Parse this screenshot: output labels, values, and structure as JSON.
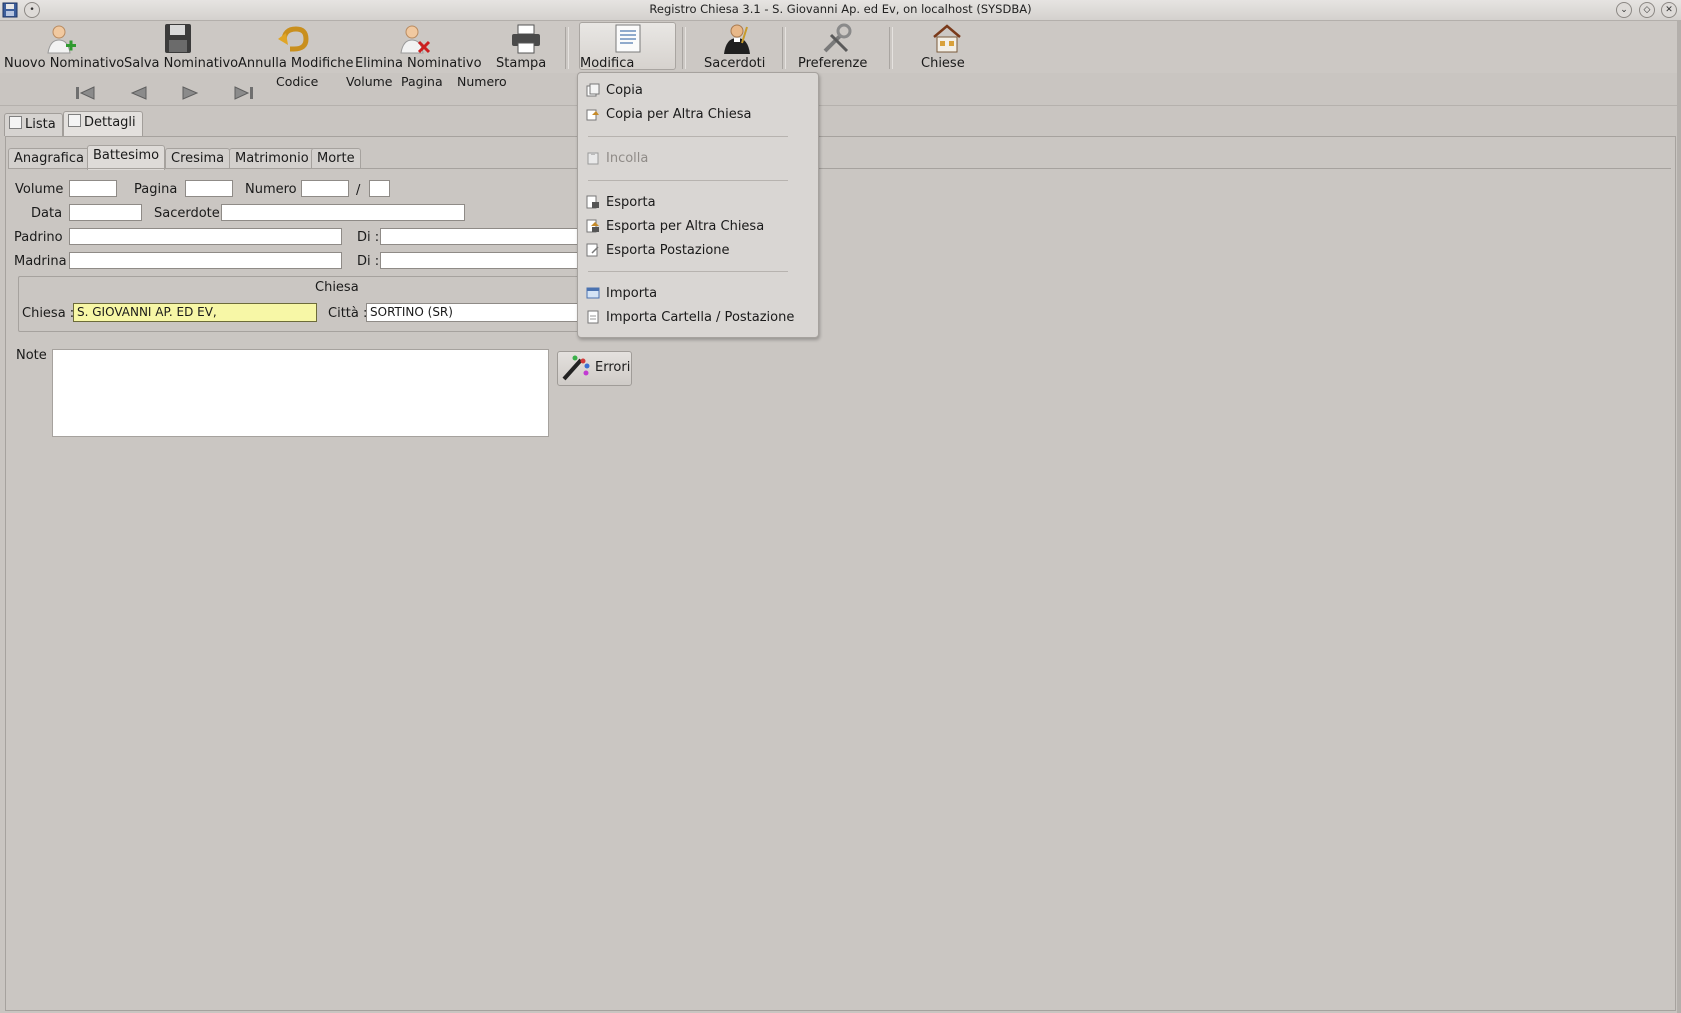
{
  "window": {
    "title": "Registro Chiesa 3.1 - S. Giovanni Ap. ed Ev, on localhost (SYSDBA)"
  },
  "toolbar": {
    "nuovo": "Nuovo Nominativo",
    "salva": "Salva Nominativo",
    "annulla": "Annulla Modifiche",
    "elimina": "Elimina Nominativo",
    "stampa": "Stampa",
    "modifica": "Modifica",
    "sacerdoti": "Sacerdoti",
    "preferenze": "Preferenze",
    "chiese": "Chiese",
    "sub_codice": "Codice",
    "sub_volume": "Volume",
    "sub_pagina": "Pagina",
    "sub_numero": "Numero"
  },
  "main_tabs": {
    "lista": "Lista",
    "dettagli": "Dettagli"
  },
  "sub_tabs": {
    "anagrafica": "Anagrafica",
    "battesimo": "Battesimo",
    "cresima": "Cresima",
    "matrimonio": "Matrimonio",
    "morte": "Morte"
  },
  "form": {
    "volume_label": "Volume",
    "pagina_label": "Pagina",
    "numero_label": "Numero",
    "slash": "/",
    "data_label": "Data",
    "sacerdote_label": "Sacerdote",
    "padrino_label": "Padrino",
    "madrina_label": "Madrina",
    "di_label": "Di :",
    "chiesa_group_title": "Chiesa",
    "chiesa_label": "Chiesa :",
    "chiesa_value": "S. GIOVANNI AP. ED EV,",
    "citta_label": "Città :",
    "citta_value": "SORTINO (SR)",
    "note_label": "Note :",
    "errori_button": "Errori"
  },
  "menu": {
    "copia": "Copia",
    "copia_altra": "Copia per Altra Chiesa",
    "incolla": "Incolla",
    "esporta": "Esporta",
    "esporta_altra": "Esporta per Altra Chiesa",
    "esporta_postazione": "Esporta Postazione",
    "importa": "Importa",
    "importa_cartella": "Importa Cartella / Postazione"
  },
  "colors": {
    "background": "#c9c5c1",
    "highlight_field": "#f7f7a6",
    "error_x": "#cc1f1f",
    "add_plus": "#2f9a2f"
  }
}
